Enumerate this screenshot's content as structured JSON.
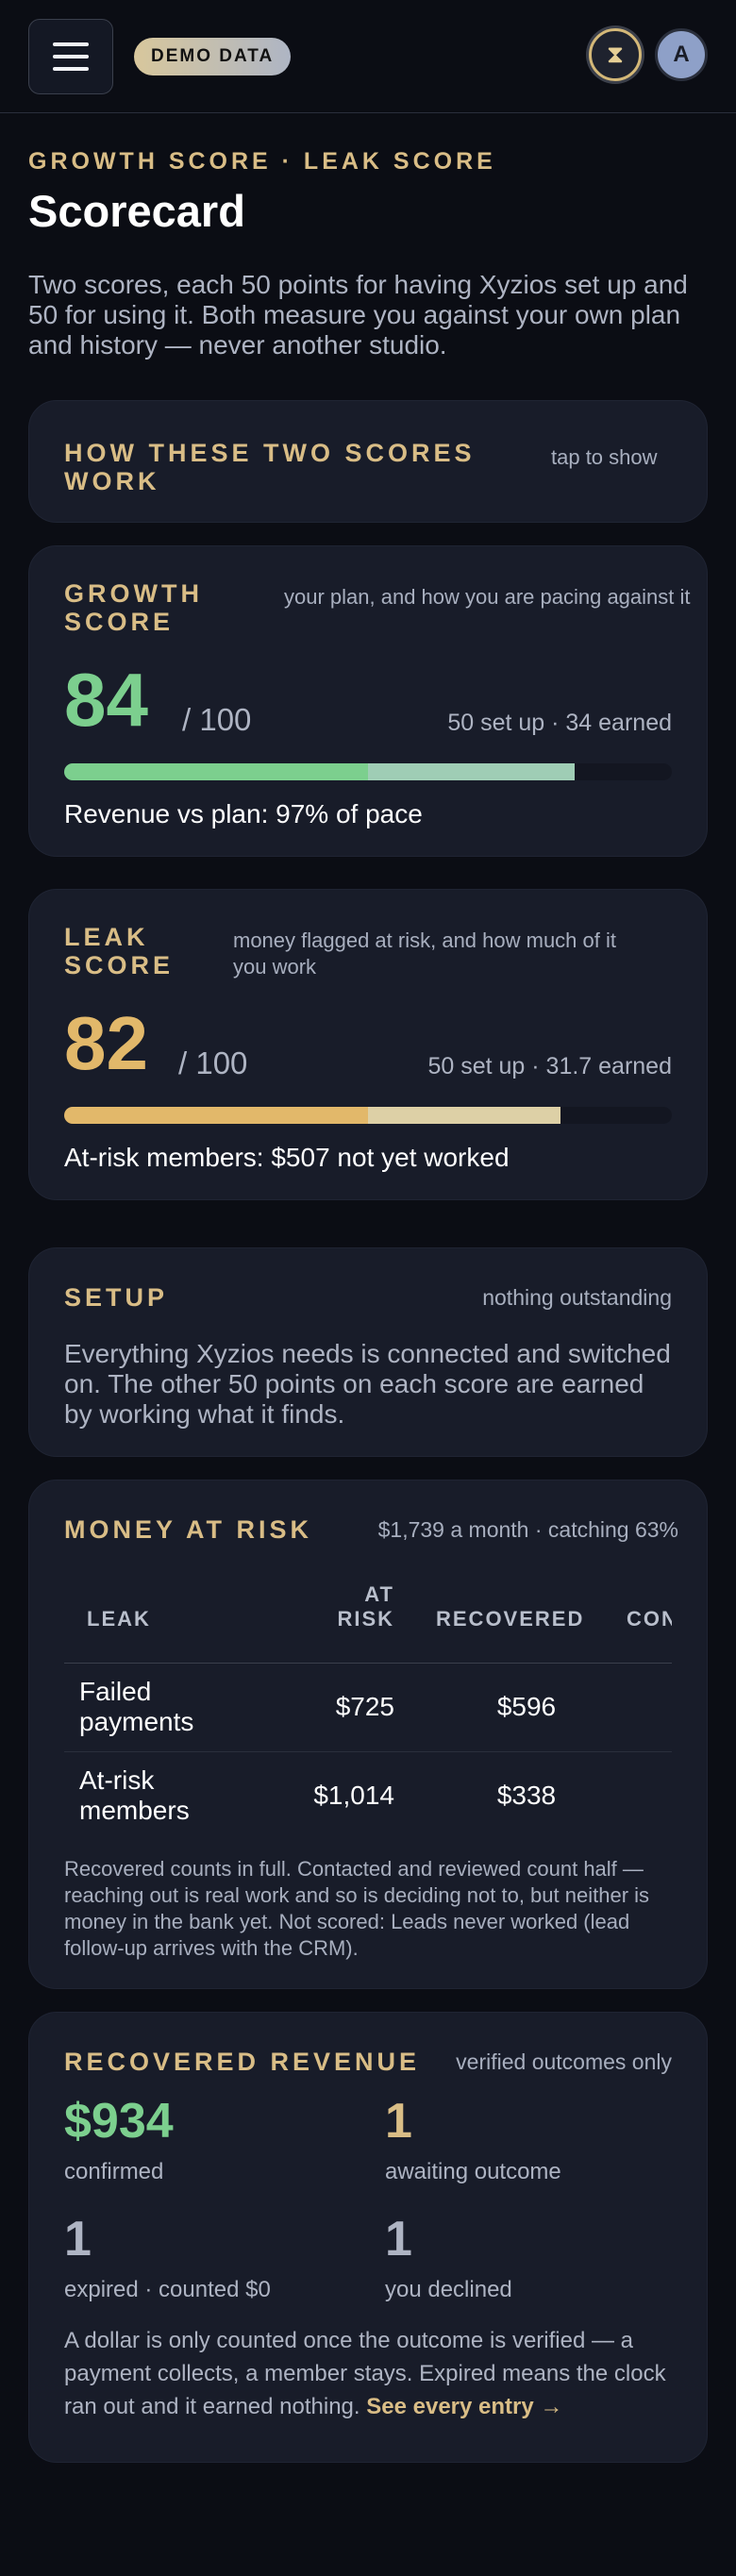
{
  "header": {
    "demo_badge": "DEMO DATA",
    "avatar_initial": "A"
  },
  "eyebrow": "GROWTH SCORE · LEAK SCORE",
  "title": "Scorecard",
  "intro": "Two scores, each 50 points for having Xyzios set up and 50 for using it. Both measure you against your own plan and history — never another studio.",
  "how": {
    "label": "HOW THESE TWO SCORES WORK",
    "hint": "tap to show"
  },
  "growth": {
    "label": "GROWTH SCORE",
    "hint": "your plan, and how you are pacing against it",
    "score": "84",
    "out_of": "/ 100",
    "setup_earned": "50 set up · 34 earned",
    "setup_points": 50,
    "earned_points": 34,
    "line": "Revenue vs plan: 97% of pace",
    "colors": {
      "score": "#7ccf8e",
      "seg1": "#7ccf8e",
      "seg2": "#9fcdb5"
    }
  },
  "leak": {
    "label": "LEAK SCORE",
    "hint": "money flagged at risk, and how much of it you work",
    "score": "82",
    "out_of": "/ 100",
    "setup_earned": "50 set up · 31.7 earned",
    "setup_points": 50,
    "earned_points": 31.7,
    "line": "At-risk members: $507 not yet worked",
    "colors": {
      "score": "#e2b86a",
      "seg1": "#e2b86a",
      "seg2": "#ddd0a6"
    }
  },
  "setup": {
    "label": "SETUP",
    "hint": "nothing outstanding",
    "body": "Everything Xyzios needs is connected and switched on. The other 50 points on each score are earned by working what it finds."
  },
  "risk": {
    "label": "MONEY AT RISK",
    "hint": "$1,739 a month · catching 63%",
    "columns": [
      "LEAK",
      "AT RISK",
      "RECOVERED",
      "CON"
    ],
    "rows": [
      {
        "leak": "Failed payments",
        "at_risk": "$725",
        "recovered": "$596"
      },
      {
        "leak": "At-risk members",
        "at_risk": "$1,014",
        "recovered": "$338"
      }
    ],
    "note": "Recovered counts in full. Contacted and reviewed count half — reaching out is real work and so is deciding not to, but neither is money in the bank yet. Not scored: Leads never worked (lead follow-up arrives with the CRM)."
  },
  "recovered": {
    "label": "RECOVERED REVENUE",
    "hint": "verified outcomes only",
    "stats": [
      {
        "value": "$934",
        "label": "confirmed"
      },
      {
        "value": "1",
        "label": "awaiting outcome"
      },
      {
        "value": "1",
        "label": "expired · counted $0"
      },
      {
        "value": "1",
        "label": "you declined"
      }
    ],
    "note": "A dollar is only counted once the outcome is verified — a payment collects, a member stays. Expired means the clock ran out and it earned nothing.",
    "link": "See every entry →",
    "colors": {
      "confirmed": "#7ccf8e",
      "awaiting": "#d9bd86",
      "neutral": "#aeb4c3"
    }
  }
}
